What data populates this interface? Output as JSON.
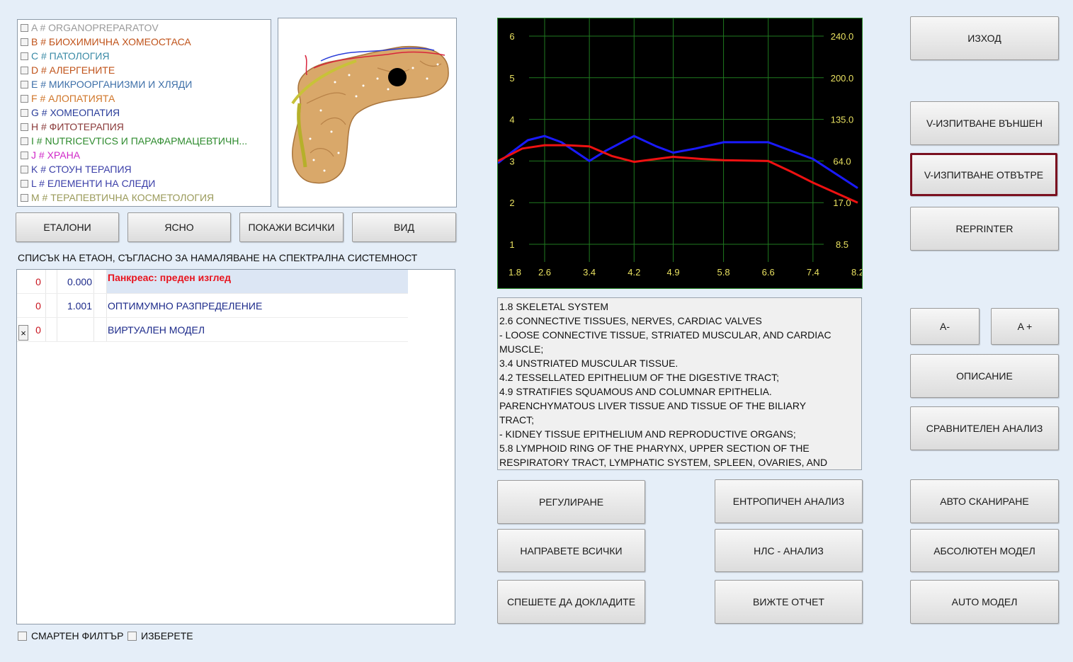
{
  "categories": [
    {
      "label": "A # ORGANOPREPARATOV",
      "color": "#9a9a9a"
    },
    {
      "label": "B # БИОХИМИЧНА ХОМЕОСТАСА",
      "color": "#c0531a"
    },
    {
      "label": "C # ПАТОЛОГИЯ",
      "color": "#3a8aa6"
    },
    {
      "label": "D # АЛЕРГЕНИТЕ",
      "color": "#c0531a"
    },
    {
      "label": "E # МИКРООРГАНИЗМИ И ХЛЯДИ",
      "color": "#3d6fa8"
    },
    {
      "label": "F # АЛОПАТИЯТА",
      "color": "#d0762a"
    },
    {
      "label": "G # ХОМЕОПАТИЯ",
      "color": "#2a3d9a"
    },
    {
      "label": "H # ФИТОТЕРАПИЯ",
      "color": "#8a3a3a"
    },
    {
      "label": "I # NUTRICEVTICS И ПАРАФАРМАЦЕВТИЧН...",
      "color": "#2e8b2e"
    },
    {
      "label": "J # ХРАНА",
      "color": "#d028c8"
    },
    {
      "label": "K # СТОУН ТЕРАПИЯ",
      "color": "#3b3fa8"
    },
    {
      "label": "L # ЕЛЕМЕНТИ НА СЛЕДИ",
      "color": "#3b3fa8"
    },
    {
      "label": "M # ТЕРАПЕВТИЧНА КОСМЕТОЛОГИЯ",
      "color": "#9a9a5a"
    }
  ],
  "toolbar": {
    "etaloni": "ЕТАЛОНИ",
    "clear": "ЯСНО",
    "show_all": "ПОКАЖИ ВСИЧКИ",
    "view": "ВИД"
  },
  "list_title": "СПИСЪК НА ЕТАОН, СЪГЛАСНО ЗА НАМАЛЯВАНЕ НА СПЕКТРАЛНА СИСТЕМНОСТ",
  "rows": [
    {
      "mark": "",
      "n": "0",
      "value": "0.000",
      "name": "Панкреас: преден изглед"
    },
    {
      "mark": "",
      "n": "0",
      "value": "1.001",
      "name": "ОПТИМУМНО РАЗПРЕДЕЛЕНИЕ"
    },
    {
      "mark": "×",
      "n": "0",
      "value": "",
      "name": "ВИРТУАЛЕН МОДЕЛ"
    }
  ],
  "bottom_checks": {
    "smart_filter": "СМАРТЕН ФИЛТЪР",
    "select": "ИЗБЕРЕТЕ"
  },
  "chart_data": {
    "type": "line",
    "x_ticks": [
      "1.8",
      "2.6",
      "3.4",
      "4.2",
      "4.9",
      "5.8",
      "6.6",
      "7.4",
      "8.2"
    ],
    "y_left_ticks": [
      "1",
      "2",
      "3",
      "4",
      "5",
      "6"
    ],
    "y_right_ticks": [
      "8.5",
      "17.0",
      "64.0",
      "135.0",
      "200.0",
      "240.0"
    ],
    "ylim": [
      0.4,
      6.6
    ],
    "grid": true,
    "colors": {
      "background": "#000000",
      "grid": "#1f7a1f",
      "axis_text": "#e8e060"
    },
    "series": [
      {
        "color": "#1a1aff",
        "x": [
          1.8,
          2.0,
          2.3,
          2.6,
          2.9,
          3.4,
          3.7,
          4.2,
          4.6,
          4.9,
          5.3,
          5.8,
          6.2,
          6.6,
          7.4,
          8.2
        ],
        "y": [
          2.95,
          3.2,
          3.5,
          3.6,
          3.45,
          3.0,
          3.25,
          3.6,
          3.35,
          3.2,
          3.3,
          3.45,
          3.45,
          3.45,
          3.05,
          2.35
        ]
      },
      {
        "color": "#ee1111",
        "x": [
          1.8,
          2.2,
          2.6,
          3.0,
          3.4,
          3.8,
          4.2,
          4.6,
          4.9,
          5.4,
          5.8,
          6.6,
          7.0,
          7.4,
          8.2
        ],
        "y": [
          3.0,
          3.3,
          3.38,
          3.38,
          3.35,
          3.12,
          2.98,
          3.05,
          3.1,
          3.05,
          3.02,
          3.0,
          2.75,
          2.48,
          2.0
        ]
      }
    ]
  },
  "description_lines": [
    "1.8 SKELETAL SYSTEM",
    "2.6 CONNECTIVE TISSUES, NERVES, CARDIAC VALVES",
    "- LOOSE CONNECTIVE TISSUE, STRIATED MUSCULAR, AND CARDIAC",
    "MUSCLE;",
    "3.4 UNSTRIATED MUSCULAR TISSUE.",
    "4.2 TESSELLATED EPITHELIUM OF THE DIGESTIVE TRACT;",
    "4.9 STRATIFIES SQUAMOUS AND COLUMNAR EPITHELIA.",
    "PARENCHYMATOUS LIVER TISSUE AND TISSUE OF THE BILIARY",
    "TRACT;",
    "- KIDNEY TISSUE EPITHELIUM AND REPRODUCTIVE ORGANS;",
    "5.8 LYMPHOID RING OF THE PHARYNX, UPPER SECTION OF THE",
    "RESPIRATORY TRACT, LYMPHATIC SYSTEM, SPLEEN, OVARIES, AND"
  ],
  "mid_buttons": {
    "regulate": "РЕГУЛИРАНЕ",
    "entropy": "ЕНТРОПИЧЕН АНАЛИЗ",
    "do_all": "НАПРАВЕТЕ ВСИЧКИ",
    "nls": "НЛС - АНАЛИЗ",
    "hurry_report": "СПЕШЕТЕ ДА ДОКЛАДИТЕ",
    "see_report": "ВИЖТЕ ОТЧЕТ"
  },
  "right_buttons": {
    "exit": "ИЗХОД",
    "v_outer": "V-ИЗПИТВАНЕ ВЪНШЕН",
    "v_inner": "V-ИЗПИТВАНЕ ОТВЪТРЕ",
    "reprinter": "REPRINTER",
    "a_minus": "A-",
    "a_plus": "A +",
    "description": "ОПИСАНИЕ",
    "compare": "СРАВНИТЕЛЕН АНАЛИЗ",
    "auto_scan": "АВТО СКАНИРАНЕ",
    "absolute_model": "АБСОЛЮТЕН МОДЕЛ",
    "auto_model": "AUTO МОДЕЛ"
  },
  "colors": {
    "selected_row_bg": "#dce6f4",
    "selected_row_text": "#e8141e",
    "row_text": "#1c2a8a",
    "value_text": "#1c2a8a",
    "n_text": "#c8141e",
    "selected_button_border": "#7a1020"
  }
}
